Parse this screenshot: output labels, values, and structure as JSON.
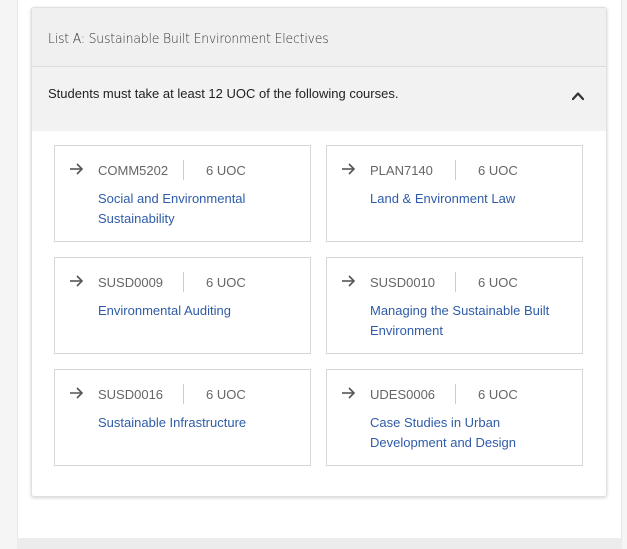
{
  "section": {
    "title": "List A: Sustainable Built Environment Electives",
    "requirement": "Students must take at least 12 UOC of the following courses.",
    "expanded": true
  },
  "courses": [
    {
      "code": "COMM5202",
      "uoc": "6 UOC",
      "title": "Social and Environmental Sustainability"
    },
    {
      "code": "PLAN7140",
      "uoc": "6 UOC",
      "title": "Land & Environment Law"
    },
    {
      "code": "SUSD0009",
      "uoc": "6 UOC",
      "title": "Environmental Auditing"
    },
    {
      "code": "SUSD0010",
      "uoc": "6 UOC",
      "title": "Managing the Sustainable Built Environment"
    },
    {
      "code": "SUSD0016",
      "uoc": "6 UOC",
      "title": "Sustainable Infrastructure"
    },
    {
      "code": "UDES0006",
      "uoc": "6 UOC",
      "title": "Case Studies in Urban Development and Design"
    }
  ],
  "icons": {
    "course_arrow": "arrow-right-icon",
    "toggle": "chevron-up-icon"
  },
  "colors": {
    "link": "#2f5ca8",
    "header_bg": "#f0f0f0"
  }
}
